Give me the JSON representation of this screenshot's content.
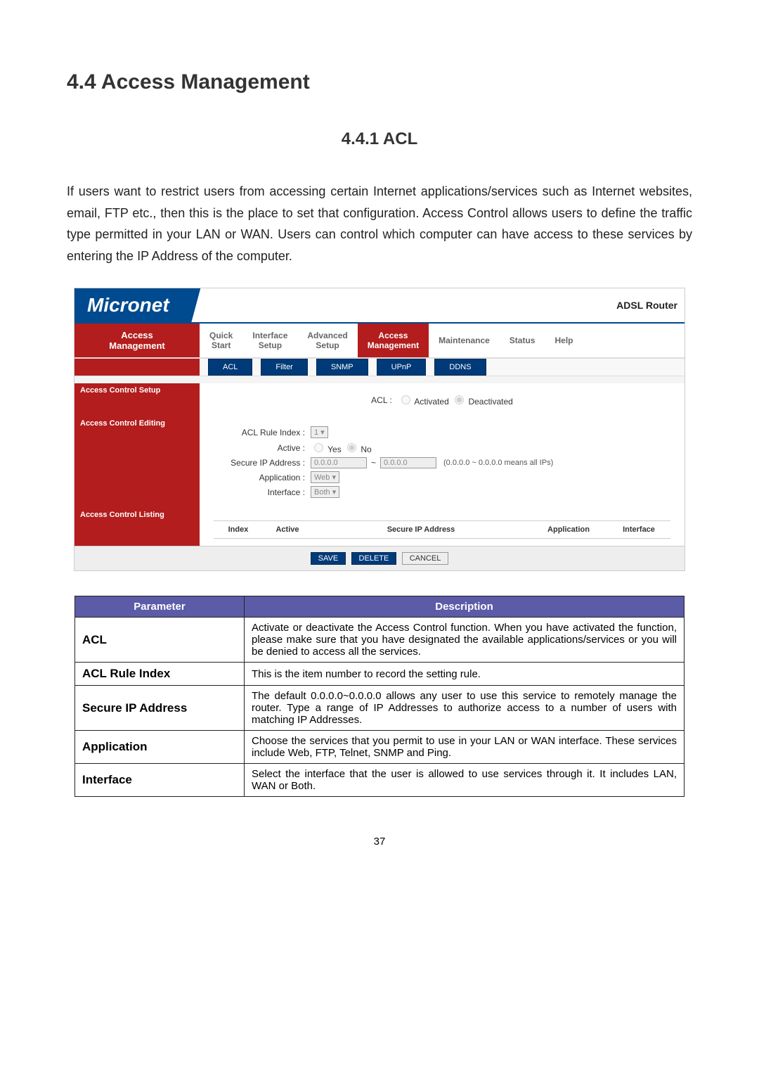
{
  "headings": {
    "h1": "4.4   Access Management",
    "h2": "4.4.1  ACL"
  },
  "intro": "If users want to restrict users from accessing certain Internet applications/services such as Internet websites, email, FTP etc., then this is the place to set that configuration. Access Control allows users to define the traffic type permitted in your LAN or WAN. Users can control which computer can have access to these services by entering the IP Address of the computer.",
  "screenshot": {
    "logo": "Micronet",
    "adsl": "ADSL Router",
    "side_tab": {
      "line1": "Access",
      "line2": "Management"
    },
    "main_tabs": {
      "quick": "Quick\nStart",
      "interface": "Interface\nSetup",
      "advanced": "Advanced\nSetup",
      "access": "Access\nManagement",
      "maintenance": "Maintenance",
      "status": "Status",
      "help": "Help"
    },
    "sub_tabs": {
      "acl": "ACL",
      "filter": "Filter",
      "snmp": "SNMP",
      "upnp": "UPnP",
      "ddns": "DDNS"
    },
    "sections": {
      "setup": "Access Control Setup",
      "editing": "Access Control Editing",
      "listing": "Access Control Listing"
    },
    "form": {
      "acl_label": "ACL :",
      "acl_activated": "Activated",
      "acl_deactivated": "Deactivated",
      "rule_index_label": "ACL Rule Index :",
      "rule_index_value": "1",
      "active_label": "Active :",
      "active_yes": "Yes",
      "active_no": "No",
      "secure_ip_label": "Secure IP Address :",
      "ip_from": "0.0.0.0",
      "ip_sep": "~",
      "ip_to": "0.0.0.0",
      "ip_note": "(0.0.0.0 ~ 0.0.0.0 means all IPs)",
      "application_label": "Application :",
      "application_value": "Web",
      "interface_label": "Interface :",
      "interface_value": "Both"
    },
    "listing_headers": {
      "index": "Index",
      "active": "Active",
      "secure": "Secure IP Address",
      "application": "Application",
      "interface": "Interface"
    },
    "buttons": {
      "save": "SAVE",
      "delete": "DELETE",
      "cancel": "CANCEL"
    }
  },
  "table": {
    "h_param": "Parameter",
    "h_desc": "Description",
    "rows": [
      {
        "param": "ACL",
        "desc": "Activate or deactivate the Access Control function. When you have activated the function, please make sure that you have designated the available applications/services or you will be denied to access all the services."
      },
      {
        "param": "ACL Rule Index",
        "desc": "This is the item number to record the setting rule."
      },
      {
        "param": "Secure IP Address",
        "desc": "The default 0.0.0.0~0.0.0.0 allows any user to use this service to remotely manage the router. Type a range of IP Addresses to authorize access to a number of users with matching IP Addresses."
      },
      {
        "param": "Application",
        "desc": "Choose the services that you permit to use in your LAN or WAN interface. These services include Web, FTP, Telnet, SNMP and Ping."
      },
      {
        "param": "Interface",
        "desc": "Select the interface that the user is allowed to use services through it. It includes LAN, WAN or Both."
      }
    ]
  },
  "page_number": "37"
}
